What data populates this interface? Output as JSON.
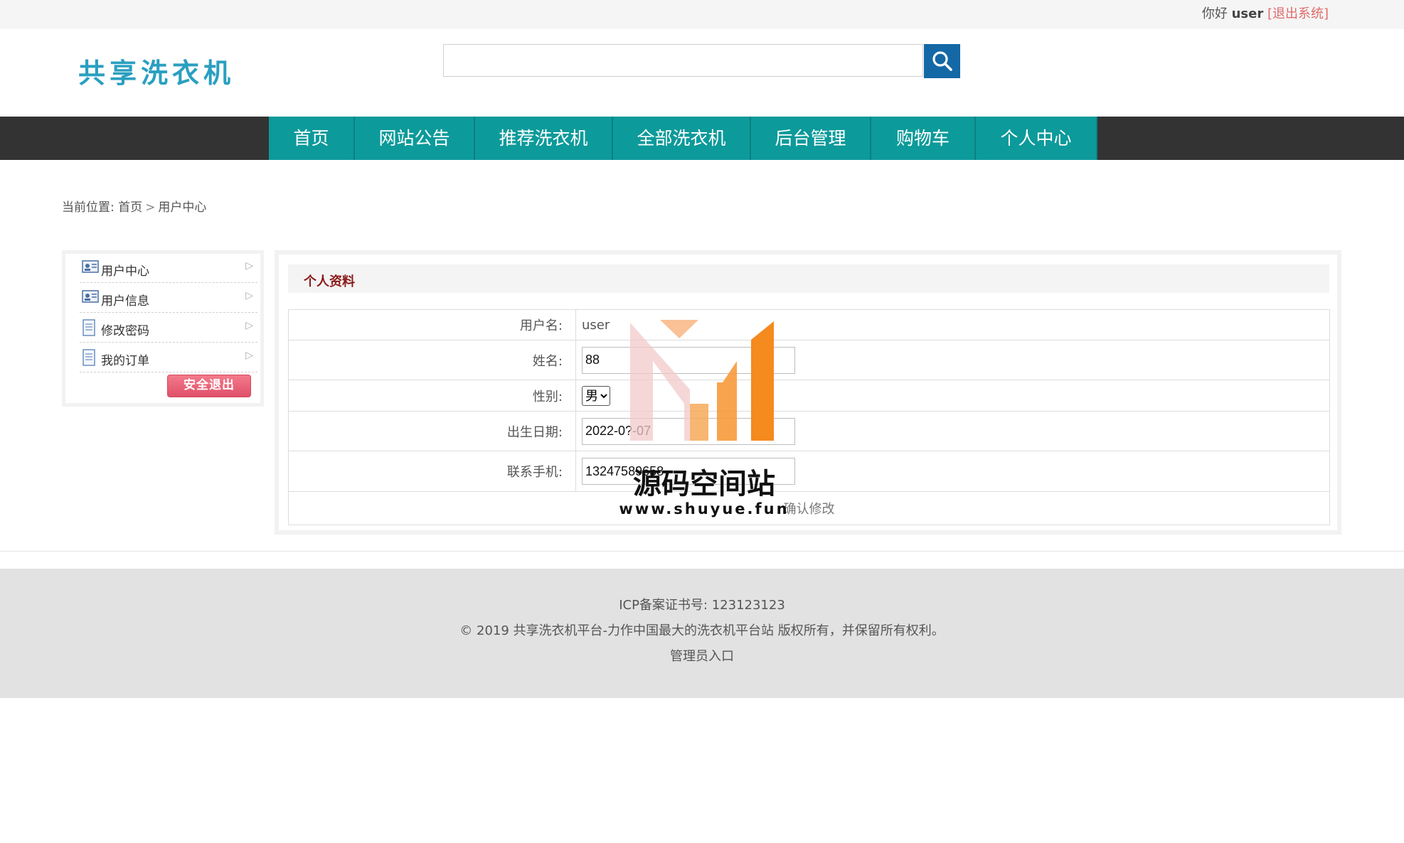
{
  "topbar": {
    "greeting": "你好",
    "username": "user",
    "logout": "[退出系统]"
  },
  "header": {
    "logo": "共享洗衣机",
    "search_placeholder": ""
  },
  "nav": {
    "items": [
      "首页",
      "网站公告",
      "推荐洗衣机",
      "全部洗衣机",
      "后台管理",
      "购物车",
      "个人中心"
    ]
  },
  "breadcrumb": {
    "prefix": "当前位置:",
    "home": "首页",
    "sep": ">",
    "current": "用户中心"
  },
  "sidebar": {
    "items": [
      "用户中心",
      "用户信息",
      "修改密码",
      "我的订单"
    ],
    "exit_button": "安全退出"
  },
  "profile": {
    "title": "个人资料",
    "fields": {
      "username_label": "用户名:",
      "username_value": "user",
      "name_label": "姓名:",
      "name_value": "88",
      "gender_label": "性别:",
      "gender_value": "男",
      "birth_label": "出生日期:",
      "birth_value": "2022-0?-07",
      "phone_label": "联系手机:",
      "phone_value": "13247589658"
    },
    "submit": "确认修改"
  },
  "watermark": {
    "text": "源码空间站",
    "url": "www.shuyue.fun"
  },
  "footer": {
    "icp": "ICP备案证书号: 123123123",
    "copyright": "© 2019 共享洗衣机平台-力作中国最大的洗衣机平台站 版权所有，并保留所有权利。",
    "admin": "管理员入口"
  },
  "colors": {
    "nav_teal": "#0d9a9a",
    "nav_bar": "#333333",
    "search_button": "#1468a6",
    "logo": "#2a9fc0",
    "panel_title": "#8b1a1a",
    "exit_button": "#e0506a",
    "watermark_orange": "#f58a1f"
  }
}
